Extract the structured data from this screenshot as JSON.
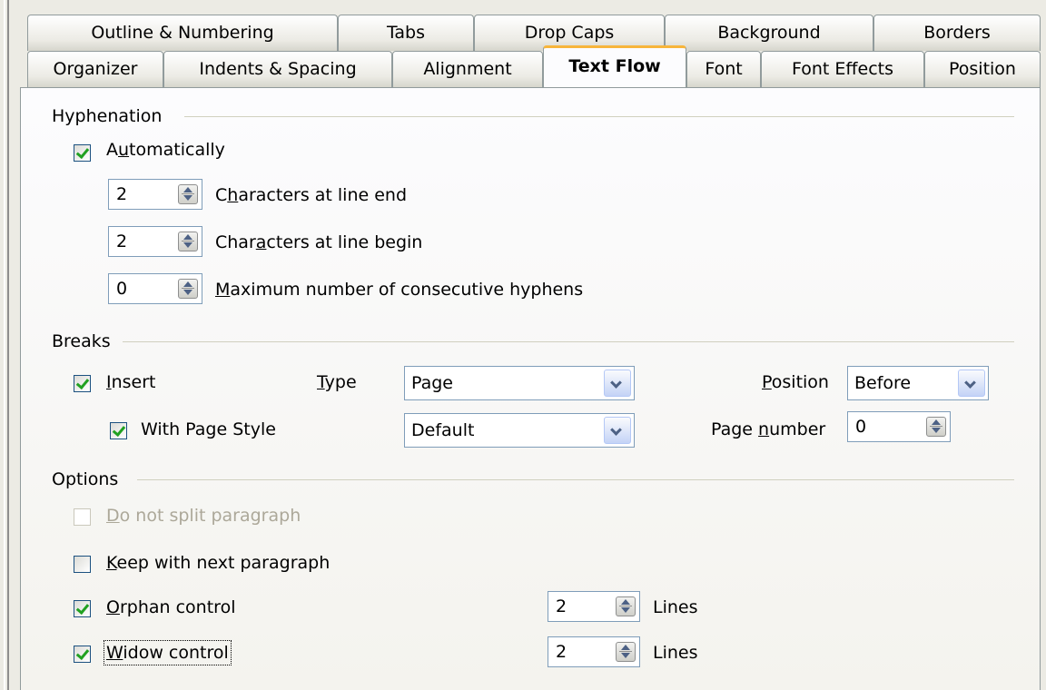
{
  "tabs_row1": [
    {
      "label": "Outline & Numbering"
    },
    {
      "label": "Tabs"
    },
    {
      "label": "Drop Caps"
    },
    {
      "label": "Background"
    },
    {
      "label": "Borders"
    }
  ],
  "tabs_row2": [
    {
      "label": "Organizer"
    },
    {
      "label": "Indents & Spacing"
    },
    {
      "label": "Alignment"
    },
    {
      "label": "Text Flow",
      "active": true
    },
    {
      "label": "Font"
    },
    {
      "label": "Font Effects"
    },
    {
      "label": "Position"
    }
  ],
  "hyphenation": {
    "title": "Hyphenation",
    "automatically": {
      "label": "Automatically",
      "checked": true
    },
    "chars_line_end": {
      "value": "2",
      "label": "Characters at line end"
    },
    "chars_line_begin": {
      "value": "2",
      "label": "Characters at line begin"
    },
    "max_hyphens": {
      "value": "0",
      "label": "Maximum number of consecutive hyphens"
    }
  },
  "breaks": {
    "title": "Breaks",
    "insert": {
      "label": "Insert",
      "checked": true
    },
    "type_label": "Type",
    "type_value": "Page",
    "position_label": "Position",
    "position_value": "Before",
    "with_page_style": {
      "label": "With Page Style",
      "checked": true
    },
    "page_style_value": "Default",
    "page_number_label": "Page number",
    "page_number_value": "0"
  },
  "options": {
    "title": "Options",
    "do_not_split": {
      "label": "Do not split paragraph",
      "checked": false,
      "disabled": true
    },
    "keep_with_next": {
      "label": "Keep with next paragraph",
      "checked": false
    },
    "orphan": {
      "label": "Orphan control",
      "checked": true,
      "lines_value": "2",
      "lines_label": "Lines"
    },
    "widow": {
      "label": "Widow control",
      "checked": true,
      "lines_value": "2",
      "lines_label": "Lines"
    }
  }
}
